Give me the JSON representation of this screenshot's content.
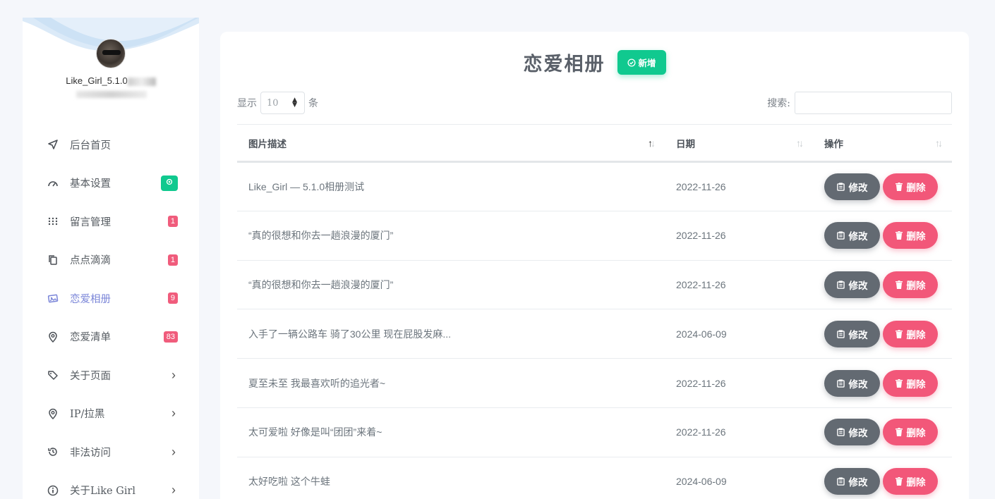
{
  "user": {
    "name": "Like_Girl_5.1.0"
  },
  "menu": [
    {
      "label": "后台首页",
      "icon": "navigation-arrow-icon"
    },
    {
      "label": "基本设置",
      "icon": "speedometer-icon",
      "badge_icon": "gear-icon"
    },
    {
      "label": "留言管理",
      "icon": "grid-dots-icon",
      "badge": "1"
    },
    {
      "label": "点点滴滴",
      "icon": "copy-icon",
      "badge": "1"
    },
    {
      "label": "恋爱相册",
      "icon": "photos-icon",
      "badge": "9",
      "active": true
    },
    {
      "label": "恋爱清单",
      "icon": "location-pin-icon",
      "badge": "83"
    },
    {
      "label": "关于页面",
      "icon": "tags-icon",
      "chevron": "›"
    },
    {
      "label": "IP/拉黑",
      "icon": "location-pin-icon",
      "chevron": "›"
    },
    {
      "label": "非法访问",
      "icon": "history-icon",
      "chevron": "›"
    },
    {
      "label": "关于Like Girl",
      "icon": "info-circle-icon",
      "chevron": "›"
    }
  ],
  "page": {
    "title": "恋爱相册",
    "add_label": "新增"
  },
  "length": {
    "prefix": "显示",
    "value": "10",
    "suffix": "条"
  },
  "search": {
    "label": "搜索:",
    "value": ""
  },
  "table": {
    "headers": [
      "图片描述",
      "日期",
      "操作"
    ],
    "edit_label": "修改",
    "delete_label": "删除",
    "rows": [
      {
        "desc": "Like_Girl — 5.1.0相册测试",
        "date": "2022-11-26"
      },
      {
        "desc": "“真的很想和你去一趟浪漫的厦门”",
        "date": "2022-11-26"
      },
      {
        "desc": "“真的很想和你去一趟浪漫的厦门”",
        "date": "2022-11-26"
      },
      {
        "desc": "入手了一辆公路车 骑了30公里 现在屁股发麻...",
        "date": "2024-06-09"
      },
      {
        "desc": "夏至未至 我最喜欢听的追光者~",
        "date": "2022-11-26"
      },
      {
        "desc": "太可爱啦 好像是叫“团团”来着~",
        "date": "2022-11-26"
      },
      {
        "desc": "太好吃啦 这个牛蛙",
        "date": "2024-06-09"
      }
    ]
  },
  "colors": {
    "accent": "#10c98f",
    "danger": "#f25779",
    "secondary": "#636a72",
    "active_menu": "#7a85d8"
  }
}
